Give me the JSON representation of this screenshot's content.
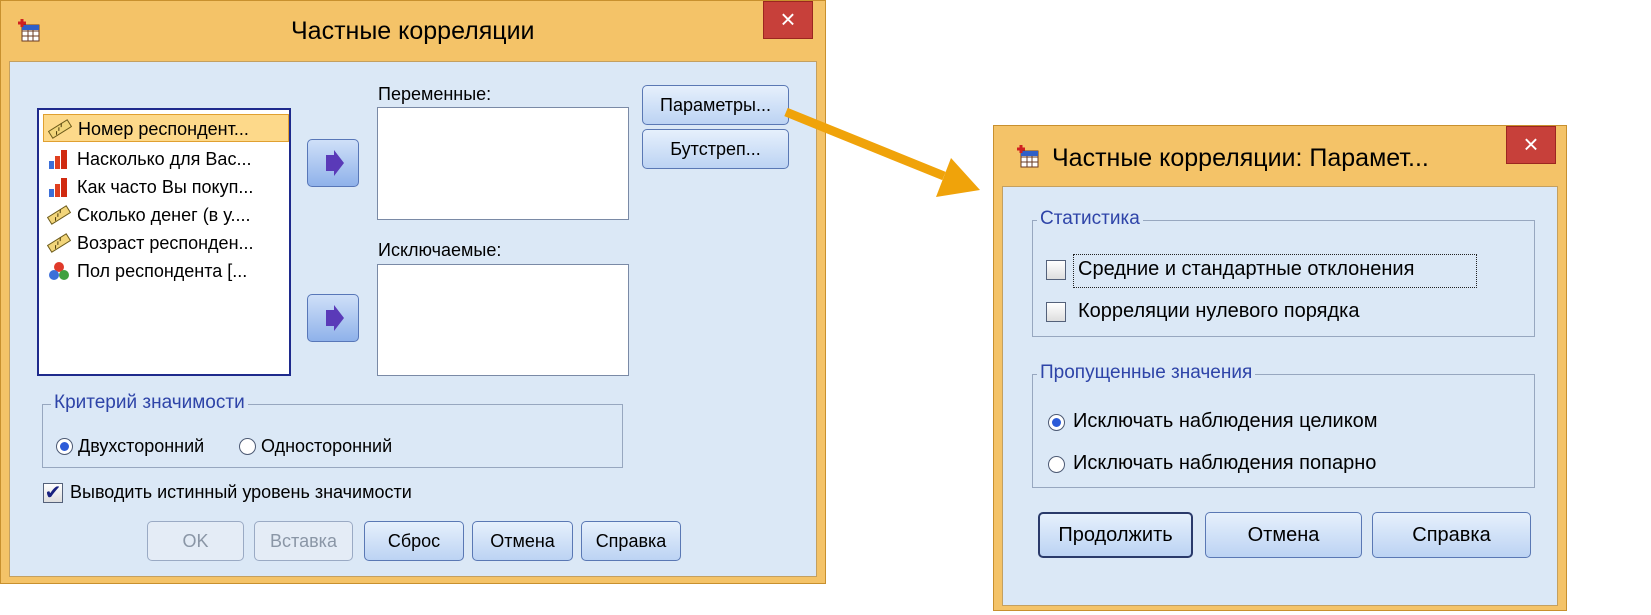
{
  "main_dialog": {
    "title": "Частные корреляции",
    "close_glyph": "×",
    "variables_list": [
      {
        "label": "Номер респондент...",
        "icon": "scale-ruler-icon",
        "selected": true
      },
      {
        "label": "Насколько для Вас...",
        "icon": "ordinal-bar-icon",
        "selected": false
      },
      {
        "label": "Как часто Вы покуп...",
        "icon": "ordinal-bar-icon",
        "selected": false
      },
      {
        "label": "Сколько денег (в у....",
        "icon": "scale-ruler-icon",
        "selected": false
      },
      {
        "label": "Возраст респонден...",
        "icon": "scale-ruler-icon",
        "selected": false
      },
      {
        "label": "Пол респондента [...",
        "icon": "nominal-circles-icon",
        "selected": false
      }
    ],
    "variables_label": "Переменные:",
    "controlling_label": "Исключаемые:",
    "options_button": "Параметры...",
    "bootstrap_button": "Бутстреп...",
    "significance_group": "Критерий значимости",
    "two_tailed": "Двухсторонний",
    "one_tailed": "Односторонний",
    "display_significance": "Выводить истинный уровень значимости",
    "buttons": {
      "ok": "OK",
      "paste": "Вставка",
      "reset": "Сброс",
      "cancel": "Отмена",
      "help": "Справка"
    }
  },
  "options_dialog": {
    "title": "Частные корреляции: Парамет...",
    "close_glyph": "×",
    "statistics_group": "Статистика",
    "means_sd": "Средние и стандартные отклонения",
    "zero_order": "Корреляции нулевого порядка",
    "missing_group": "Пропущенные значения",
    "listwise": "Исключать наблюдения целиком",
    "pairwise": "Исключать наблюдения попарно",
    "buttons": {
      "continue": "Продолжить",
      "cancel": "Отмена",
      "help": "Справка"
    }
  },
  "colors": {
    "frame": "#f4c368",
    "client": "#dbe8f6",
    "close": "#c7403a",
    "arrow": "#f0a30a",
    "group_title": "#2e44a8"
  }
}
